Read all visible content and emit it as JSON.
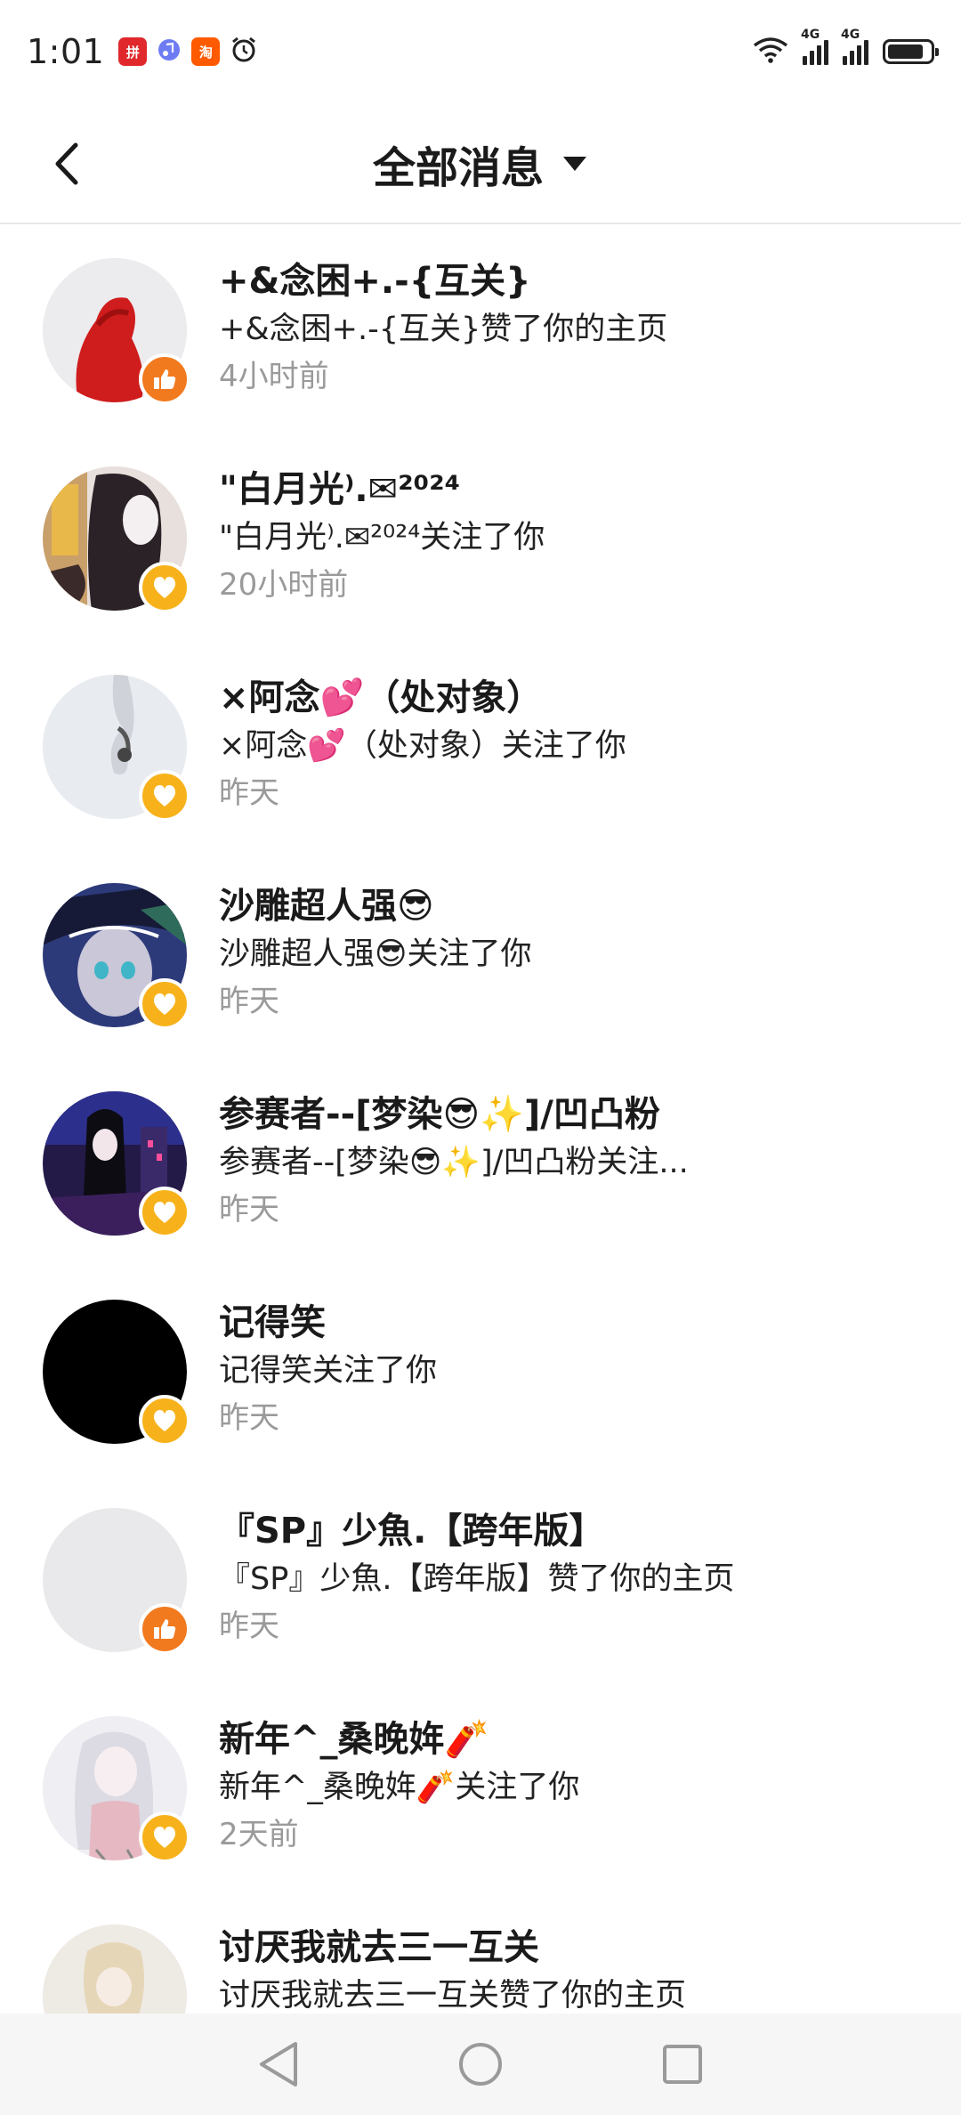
{
  "status_bar": {
    "time": "1:01",
    "apps": [
      "pdd",
      "music",
      "taobao",
      "alarm"
    ],
    "net1": "4G",
    "net2": "4G"
  },
  "header": {
    "title": "全部消息",
    "back_icon": "chevron-left-icon",
    "dropdown_icon": "caret-down-icon"
  },
  "messages": [
    {
      "name": "+&念困+.-{互关}",
      "desc": "+&念困+.-{互关}赞了你的主页",
      "time": "4小时前",
      "type": "like"
    },
    {
      "name": "\"白月光⁾.✉²⁰²⁴",
      "desc": "\"白月光⁾.✉²⁰²⁴关注了你",
      "time": "20小时前",
      "type": "follow"
    },
    {
      "name": "×阿念💕（处对象）",
      "desc": "×阿念💕（处对象）关注了你",
      "time": "昨天",
      "type": "follow"
    },
    {
      "name": "沙雕超人强😎",
      "desc": "沙雕超人强😎关注了你",
      "time": "昨天",
      "type": "follow"
    },
    {
      "name": "参赛者--[梦染😎✨]/凹凸粉",
      "desc": "参赛者--[梦染😎✨]/凹凸粉关注...",
      "time": "昨天",
      "type": "follow"
    },
    {
      "name": "记得笑",
      "desc": "记得笑关注了你",
      "time": "昨天",
      "type": "follow"
    },
    {
      "name": "『SP』少魚.【跨年版】",
      "desc": "『SP』少魚.【跨年版】赞了你的主页",
      "time": "昨天",
      "type": "like"
    },
    {
      "name": "新年^_桑晚姩🧨",
      "desc": "新年^_桑晚姩🧨关注了你",
      "time": "2天前",
      "type": "follow"
    },
    {
      "name": "讨厌我就去三一互关",
      "desc": "讨厌我就去三一互关赞了你的主页",
      "time": "",
      "type": "like"
    }
  ],
  "bottom_nav": {
    "back": "back-triangle-icon",
    "home": "home-circle-icon",
    "recents": "recents-square-icon"
  }
}
